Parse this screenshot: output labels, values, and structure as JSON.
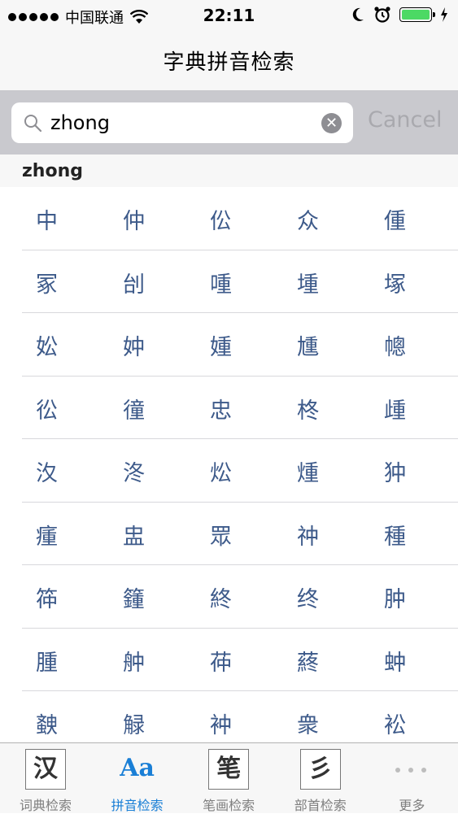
{
  "status": {
    "carrier": "中国联通",
    "time": "22:11",
    "battery_level": 1.0,
    "battery_color": "#4cd964"
  },
  "nav": {
    "title": "字典拼音检索"
  },
  "search": {
    "value": "zhong",
    "cancel_label": "Cancel"
  },
  "section": {
    "header": "zhong"
  },
  "characters": [
    [
      "中",
      "仲",
      "伀",
      "众",
      "偅"
    ],
    [
      "冢",
      "刣",
      "喠",
      "堹",
      "塚"
    ],
    [
      "妐",
      "妕",
      "媑",
      "尰",
      "幒"
    ],
    [
      "彸",
      "徸",
      "忠",
      "柊",
      "歱"
    ],
    [
      "汷",
      "泈",
      "炂",
      "煄",
      "狆"
    ],
    [
      "瘇",
      "盅",
      "眾",
      "祌",
      "種"
    ],
    [
      "筗",
      "籦",
      "終",
      "终",
      "肿"
    ],
    [
      "腫",
      "舯",
      "茽",
      "蔠",
      "蚛"
    ],
    [
      "螤",
      "觮",
      "衶",
      "衆",
      "衳"
    ]
  ],
  "tabs": [
    {
      "icon_text": "汉",
      "label": "词典检索",
      "active": false
    },
    {
      "icon_text": "Aa",
      "label": "拼音检索",
      "active": true
    },
    {
      "icon_text": "笔",
      "label": "笔画检索",
      "active": false
    },
    {
      "icon_text": "彡",
      "label": "部首检索",
      "active": false
    },
    {
      "icon_text": "",
      "label": "更多",
      "active": false
    }
  ],
  "colors": {
    "accent": "#1a7fd6",
    "character_text": "#3d5a8a"
  }
}
